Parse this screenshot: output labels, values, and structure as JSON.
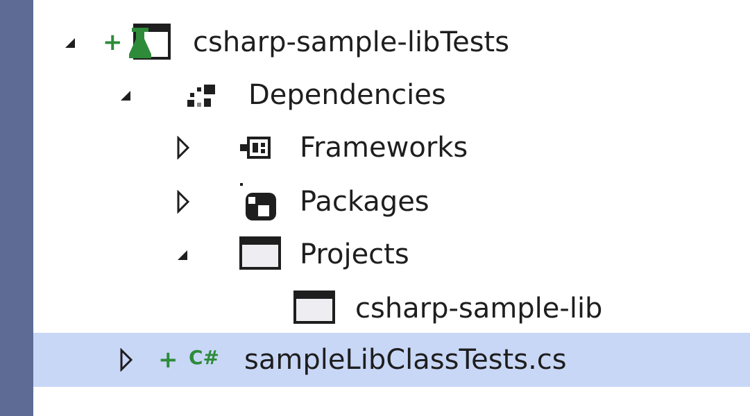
{
  "tree": {
    "root": {
      "label": "csharp-sample-libTests",
      "icon": "test-project-icon",
      "state": "expanded"
    },
    "dependencies": {
      "label": "Dependencies",
      "icon": "dependencies-icon",
      "state": "expanded"
    },
    "frameworks": {
      "label": "Frameworks",
      "icon": "framework-icon",
      "state": "collapsed"
    },
    "packages": {
      "label": "Packages",
      "icon": "nuget-package-icon",
      "state": "collapsed"
    },
    "projects": {
      "label": "Projects",
      "icon": "project-reference-icon",
      "state": "expanded"
    },
    "project_ref": {
      "label": "csharp-sample-lib",
      "icon": "project-reference-icon"
    },
    "file": {
      "label": "sampleLibClassTests.cs",
      "icon": "csharp-file-icon",
      "badge": "C#",
      "state": "collapsed",
      "selected": true
    }
  },
  "colors": {
    "sidebar": "#5d6b95",
    "selection": "#c9d7f7",
    "added_marker": "#2e8b3a",
    "text": "#1e1e1e"
  }
}
